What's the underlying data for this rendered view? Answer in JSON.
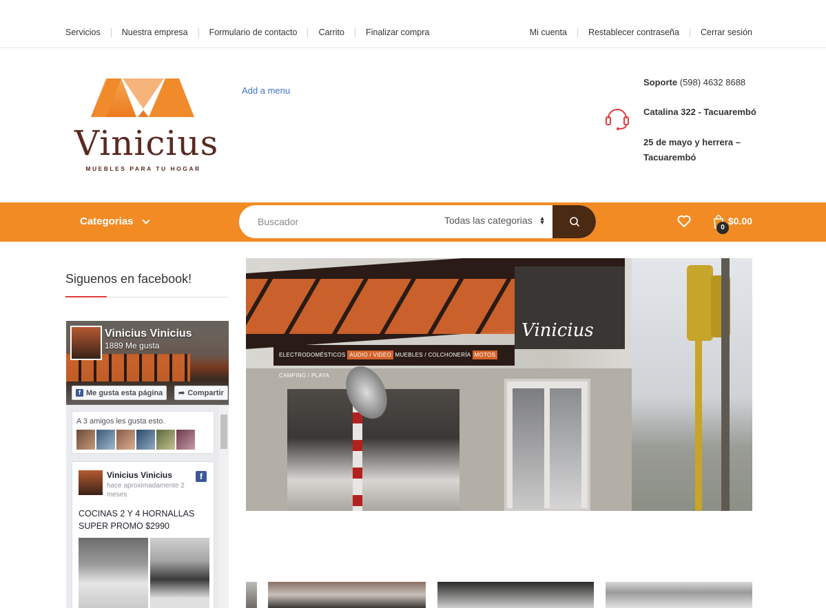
{
  "topbar": {
    "left_links": [
      "Servicios",
      "Nuestra empresa",
      "Formulario de contacto",
      "Carrito",
      "Finalizar compra"
    ],
    "right_links": [
      "Mi cuenta",
      "Restablecer contraseña",
      "Cerrar sesión"
    ]
  },
  "header": {
    "logo_text": "Vinicius",
    "logo_tagline": "MUEBLES PARA TU HOGAR",
    "add_menu": "Add a menu",
    "support_label": "Soporte",
    "support_phone": "(598) 4632 8688",
    "address_1": "Catalina 322 - Tacuarembó",
    "address_2a": "25 de mayo y herrera –",
    "address_2b": "Tacuarembó"
  },
  "navbar": {
    "categories_label": "Categorias",
    "search_placeholder": "Buscador",
    "category_select": "Todas las categorias",
    "cart_count": "0",
    "cart_total": "$0.00"
  },
  "sidebar": {
    "widget_title": "Siguenos en facebook!",
    "fb_page_name": "Vinicius Vinicius",
    "fb_likes": "1889 Me gusta",
    "fb_like_button": "Me gusta esta página",
    "fb_share_button": "Compartir",
    "fb_friends_text": "A 3 amigos les gusta esto.",
    "post": {
      "author": "Vinicius Vinicius",
      "time": "hace aproximadamente 2 meses",
      "text": "COCINAS 2 Y 4 HORNALLAS SUPER PROMO $2990"
    }
  },
  "banner": {
    "sign_text": "Vinicius",
    "strip_text_1": "ELECTRODOMÉSTICOS",
    "strip_text_2": "AUDIO / VIDEO",
    "strip_text_3": "MUEBLES / COLCHONERÍA",
    "strip_text_4": "MOTOS",
    "strip_text_5": "CAMPING / PLAYA"
  },
  "colors": {
    "brand_orange": "#f28b24",
    "search_button": "#4a2a13",
    "logo_brown": "#5a2a22",
    "link_blue": "#3b74c6",
    "accent_red": "#e03b3b"
  },
  "icons": [
    "headset-icon",
    "chevron-down-icon",
    "search-icon",
    "heart-icon",
    "shopping-bag-icon",
    "facebook-icon",
    "share-icon"
  ]
}
